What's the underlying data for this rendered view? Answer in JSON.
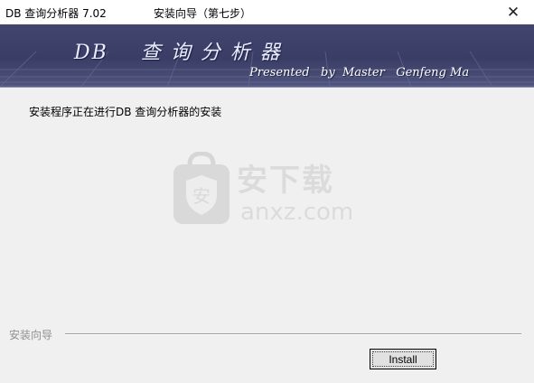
{
  "window": {
    "app_title": "DB 查询分析器 7.02",
    "wizard_title": "安装向导（第七步）",
    "close_glyph": "✕"
  },
  "banner": {
    "title": "DB    查 询 分 析 器",
    "subtitle": "Presented   by  Master   Genfeng Ma",
    "colors": {
      "background": "#42466f",
      "text": "#ffffff"
    }
  },
  "content": {
    "status_text": "安装程序正在进行DB 查询分析器的安装"
  },
  "watermark": {
    "line1": "安下载",
    "line2": "anxz.com",
    "icon": "shield-bag-icon"
  },
  "footer": {
    "group_label": "安装向导",
    "install_button": "Install"
  }
}
